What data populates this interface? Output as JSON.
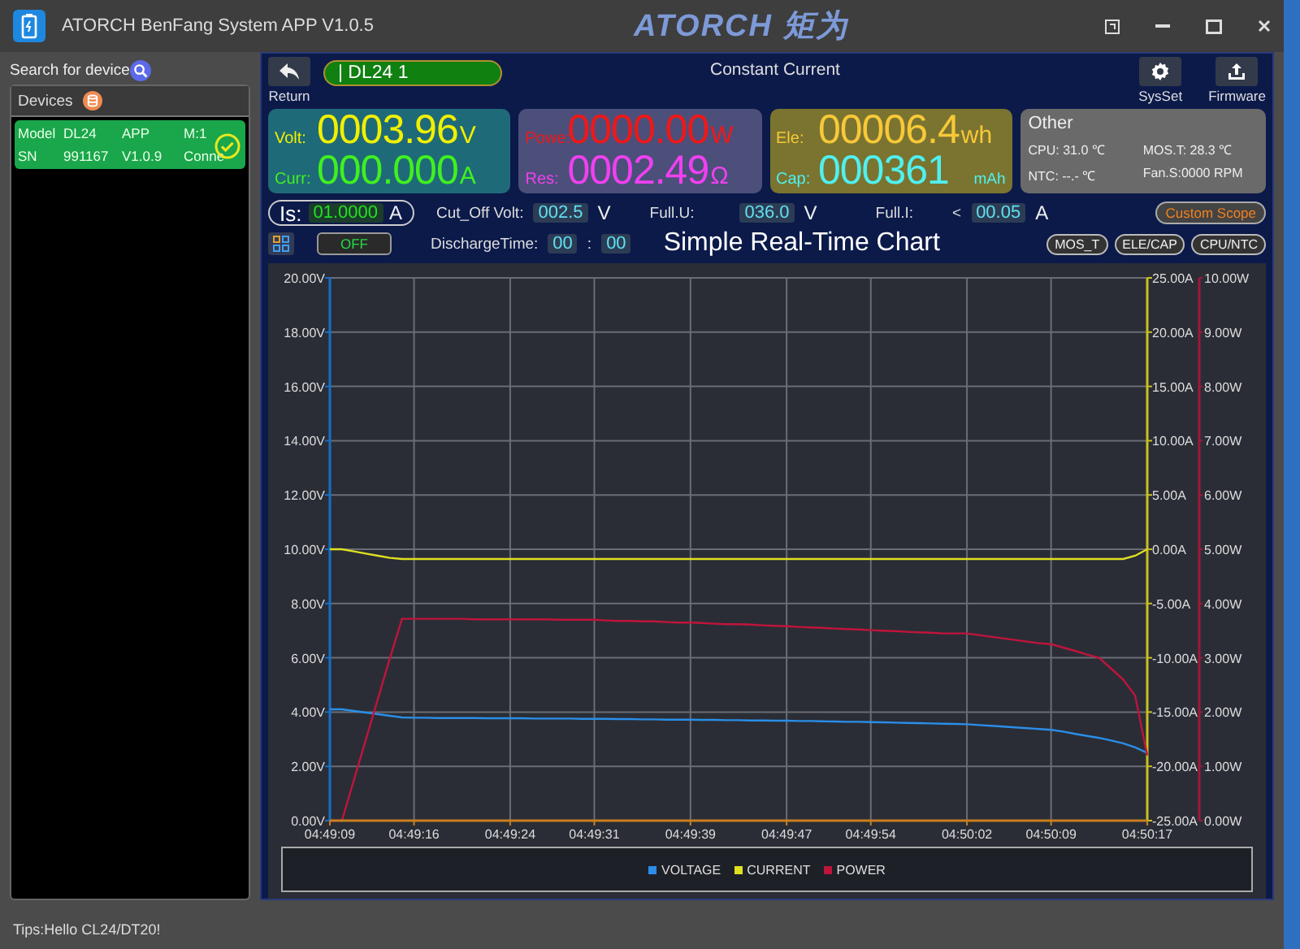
{
  "window": {
    "title": "ATORCH BenFang System APP V1.0.5",
    "logo": "ATORCH 矩为"
  },
  "sidebar": {
    "search_label": "Search for device",
    "devices_header": "Devices",
    "devices": [
      {
        "selected": true,
        "connected": true,
        "rows": [
          [
            "Model",
            "DL24",
            "APP",
            "M:1"
          ],
          [
            "SN",
            "991167",
            "V1.0.9",
            "Conne"
          ]
        ]
      }
    ]
  },
  "toolbar": {
    "return_label": "Return",
    "device": "| DL24 1",
    "mode": "Constant Current",
    "buttons": [
      {
        "kind": "gear",
        "label": "SysSet"
      },
      {
        "kind": "upload",
        "label": "Firmware"
      }
    ]
  },
  "readouts": [
    {
      "color": "#1f6a78",
      "rows": [
        {
          "label": "Volt:",
          "value": "0003.96",
          "unit": "V",
          "color": "#f0f000"
        },
        {
          "label": "Curr:",
          "value": "000.000",
          "unit": "A",
          "color": "#40f020"
        }
      ]
    },
    {
      "color": "#4c4f7a",
      "rows": [
        {
          "label": "Powe:",
          "value": "0000.00",
          "unit": "W",
          "color": "#f01818"
        },
        {
          "label": "Res:",
          "value": "0002.49",
          "unit": "Ω",
          "color": "#f040f0"
        }
      ]
    },
    {
      "color": "#7a7430",
      "rows": [
        {
          "label": "Ele:",
          "value": "00006.4",
          "unit": "wh",
          "color": "#f8c838"
        },
        {
          "label": "Cap:",
          "value": "000361",
          "unit": "mAh",
          "color": "#50f0f0"
        }
      ]
    }
  ],
  "other": {
    "title": "Other",
    "items": [
      "CPU: 31.0 ℃",
      "MOS.T: 28.3 ℃",
      "NTC: --.- ℃",
      "Fan.S:0000 RPM"
    ]
  },
  "settings": {
    "is_label": "Is:",
    "is_value": "01.0000",
    "is_unit": "A",
    "cutoff_label": "Cut_Off Volt:",
    "cutoff_value": "002.5",
    "cutoff_unit": "V",
    "fullu_label": "Full.U:",
    "fullu_value": "036.0",
    "fullu_unit": "V",
    "fulli_label": "Full.I:",
    "fulli_prefix": "<",
    "fulli_value": "00.05",
    "fulli_unit": "A",
    "custom_scope": "Custom Scope",
    "switch": {
      "label": "OFF",
      "on": false
    },
    "time_label": "DischargeTime:",
    "time_h": "00",
    "time_sep": ":",
    "time_m": "00"
  },
  "chart": {
    "title": "Simple Real-Time Chart",
    "buttons": [
      "MOS_T",
      "ELE/CAP",
      "CPU/NTC"
    ],
    "chart_data": {
      "type": "line",
      "categories": [
        "04:49:09",
        null,
        null,
        null,
        null,
        null,
        null,
        "04:49:16",
        null,
        null,
        null,
        null,
        null,
        null,
        null,
        "04:49:24",
        null,
        null,
        null,
        null,
        null,
        null,
        "04:49:31",
        null,
        null,
        null,
        null,
        null,
        null,
        null,
        "04:49:39",
        null,
        null,
        null,
        null,
        null,
        null,
        null,
        "04:49:47",
        null,
        null,
        null,
        null,
        null,
        null,
        "04:49:54",
        null,
        null,
        null,
        null,
        null,
        null,
        null,
        "04:50:02",
        null,
        null,
        null,
        null,
        null,
        null,
        "04:50:09",
        null,
        null,
        null,
        null,
        null,
        null,
        null,
        "04:50:17"
      ],
      "grid": true,
      "ylim": [
        0,
        20
      ],
      "yticks": [
        {
          "value": 0,
          "label": "0.00V"
        },
        {
          "value": 2,
          "label": "2.00V"
        },
        {
          "value": 4,
          "label": "4.00V"
        },
        {
          "value": 6,
          "label": "6.00V"
        },
        {
          "value": 8,
          "label": "8.00V"
        },
        {
          "value": 10,
          "label": "10.00V"
        },
        {
          "value": 12,
          "label": "12.00V"
        },
        {
          "value": 14,
          "label": "14.00V"
        },
        {
          "value": 16,
          "label": "16.00V"
        },
        {
          "value": 18,
          "label": "18.00V"
        },
        {
          "value": 20,
          "label": "20.00V"
        }
      ],
      "y2lim": [
        -25,
        25
      ],
      "y2ticks": [
        {
          "value": -25,
          "label": "-25.00A"
        },
        {
          "value": -20,
          "label": "-20.00A"
        },
        {
          "value": -15,
          "label": "-15.00A"
        },
        {
          "value": -10,
          "label": "-10.00A"
        },
        {
          "value": -5,
          "label": "-5.00A"
        },
        {
          "value": 0,
          "label": "0.00A"
        },
        {
          "value": 5,
          "label": "5.00A"
        },
        {
          "value": 10,
          "label": "10.00A"
        },
        {
          "value": 15,
          "label": "15.00A"
        },
        {
          "value": 20,
          "label": "20.00A"
        },
        {
          "value": 25,
          "label": "25.00A"
        }
      ],
      "y3lim": [
        0,
        10
      ],
      "y3ticks": [
        {
          "value": 0,
          "label": "0.00W"
        },
        {
          "value": 1,
          "label": "1.00W"
        },
        {
          "value": 2,
          "label": "2.00W"
        },
        {
          "value": 3,
          "label": "3.00W"
        },
        {
          "value": 4,
          "label": "4.00W"
        },
        {
          "value": 5,
          "label": "5.00W"
        },
        {
          "value": 6,
          "label": "6.00W"
        },
        {
          "value": 7,
          "label": "7.00W"
        },
        {
          "value": 8,
          "label": "8.00W"
        },
        {
          "value": 9,
          "label": "9.00W"
        },
        {
          "value": 10,
          "label": "10.00W"
        }
      ],
      "series": [
        {
          "name": "VOLTAGE",
          "color": "#2a8ee8",
          "axis": "y",
          "values": [
            4.1,
            4.1,
            4.04,
            3.98,
            3.92,
            3.86,
            3.8,
            3.79,
            3.79,
            3.78,
            3.78,
            3.78,
            3.78,
            3.77,
            3.77,
            3.77,
            3.77,
            3.76,
            3.76,
            3.76,
            3.76,
            3.75,
            3.75,
            3.75,
            3.74,
            3.74,
            3.73,
            3.73,
            3.72,
            3.72,
            3.72,
            3.71,
            3.71,
            3.7,
            3.7,
            3.69,
            3.69,
            3.68,
            3.68,
            3.67,
            3.67,
            3.66,
            3.65,
            3.64,
            3.64,
            3.63,
            3.62,
            3.61,
            3.6,
            3.59,
            3.58,
            3.57,
            3.56,
            3.55,
            3.52,
            3.5,
            3.47,
            3.44,
            3.41,
            3.38,
            3.35,
            3.28,
            3.2,
            3.12,
            3.05,
            2.95,
            2.85,
            2.7,
            2.5
          ]
        },
        {
          "name": "CURRENT",
          "color": "#e0e020",
          "axis": "y2",
          "values": [
            0,
            0,
            -0.2,
            -0.4,
            -0.6,
            -0.8,
            -0.9,
            -0.9,
            -0.9,
            -0.9,
            -0.9,
            -0.9,
            -0.9,
            -0.9,
            -0.9,
            -0.9,
            -0.9,
            -0.9,
            -0.9,
            -0.9,
            -0.9,
            -0.9,
            -0.9,
            -0.9,
            -0.9,
            -0.9,
            -0.9,
            -0.9,
            -0.9,
            -0.9,
            -0.9,
            -0.9,
            -0.9,
            -0.9,
            -0.9,
            -0.9,
            -0.9,
            -0.9,
            -0.9,
            -0.9,
            -0.9,
            -0.9,
            -0.9,
            -0.9,
            -0.9,
            -0.9,
            -0.9,
            -0.9,
            -0.9,
            -0.9,
            -0.9,
            -0.9,
            -0.9,
            -0.9,
            -0.9,
            -0.9,
            -0.9,
            -0.9,
            -0.9,
            -0.9,
            -0.9,
            -0.9,
            -0.9,
            -0.9,
            -0.9,
            -0.9,
            -0.9,
            -0.6,
            0
          ]
        },
        {
          "name": "POWER",
          "color": "#c0143c",
          "axis": "y3",
          "values": [
            0,
            0,
            0.75,
            1.5,
            2.25,
            3.0,
            3.72,
            3.72,
            3.72,
            3.72,
            3.72,
            3.72,
            3.71,
            3.71,
            3.71,
            3.71,
            3.71,
            3.71,
            3.71,
            3.7,
            3.7,
            3.7,
            3.7,
            3.69,
            3.68,
            3.68,
            3.67,
            3.67,
            3.66,
            3.65,
            3.65,
            3.64,
            3.63,
            3.62,
            3.62,
            3.61,
            3.6,
            3.59,
            3.58,
            3.57,
            3.56,
            3.55,
            3.54,
            3.53,
            3.52,
            3.51,
            3.5,
            3.49,
            3.48,
            3.47,
            3.46,
            3.45,
            3.45,
            3.45,
            3.42,
            3.39,
            3.36,
            3.33,
            3.3,
            3.27,
            3.25,
            3.19,
            3.13,
            3.06,
            3.0,
            2.8,
            2.6,
            2.3,
            1.2
          ]
        }
      ]
    }
  },
  "status_bar": "Tips:Hello CL24/DT20!"
}
